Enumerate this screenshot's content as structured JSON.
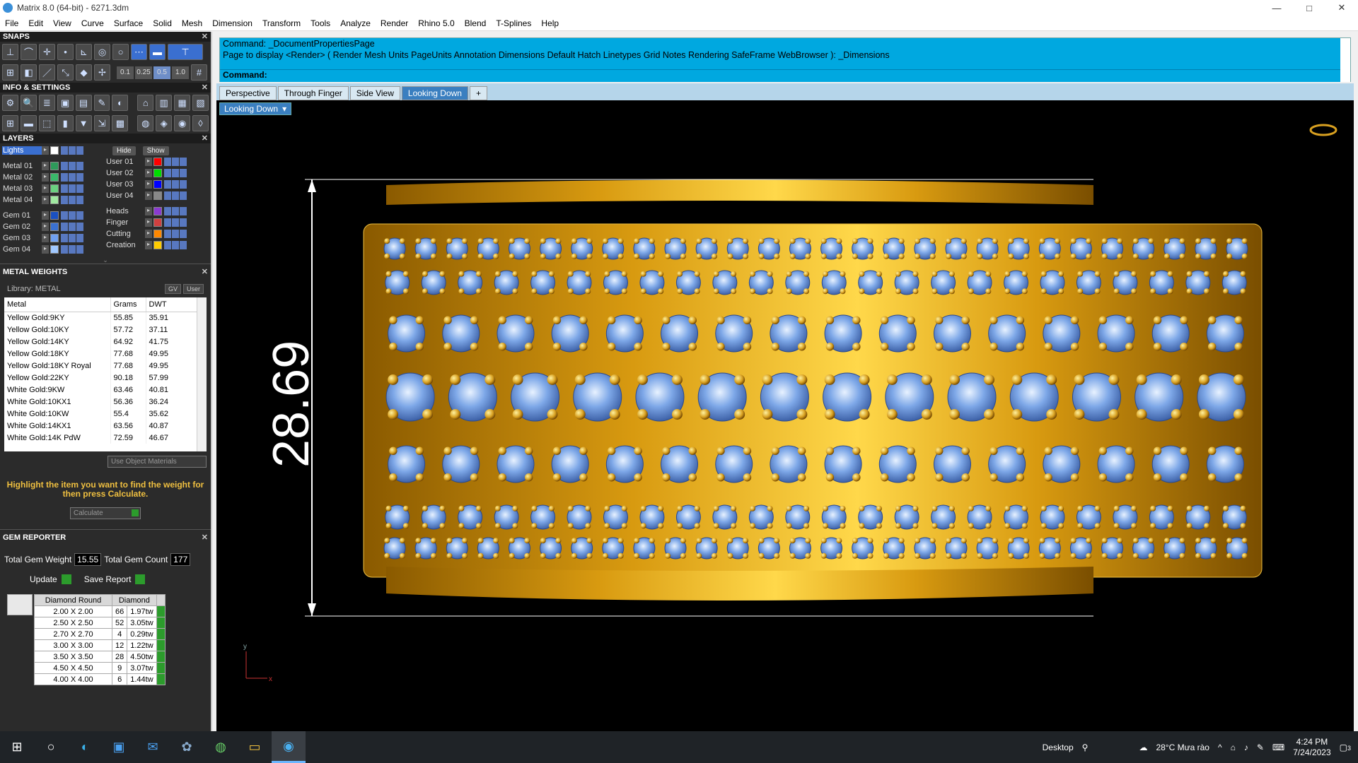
{
  "window": {
    "title": "Matrix 8.0 (64-bit) - 6271.3dm",
    "minimize": "—",
    "maximize": "□",
    "close": "✕"
  },
  "menu": [
    "File",
    "Edit",
    "View",
    "Curve",
    "Surface",
    "Solid",
    "Mesh",
    "Dimension",
    "Transform",
    "Tools",
    "Analyze",
    "Render",
    "Rhino 5.0",
    "Blend",
    "T-Splines",
    "Help"
  ],
  "panels": {
    "snaps": {
      "title": "SNAPS",
      "values": [
        "0.1",
        "0.25",
        "0.5",
        "1.0"
      ],
      "selected": "0.5"
    },
    "info": {
      "title": "INFO & SETTINGS"
    },
    "layers": {
      "title": "LAYERS",
      "hide": "Hide",
      "show": "Show",
      "left": [
        [
          "Lights",
          "#ffffff"
        ],
        [
          "Metal 01",
          "#2e9a5a"
        ],
        [
          "Metal 02",
          "#3ab86a"
        ],
        [
          "Metal 03",
          "#6ad080"
        ],
        [
          "Metal 04",
          "#a0e8a0"
        ],
        [
          "Gem 01",
          "#1a50c0"
        ],
        [
          "Gem 02",
          "#3a70d0"
        ],
        [
          "Gem 03",
          "#70a0f0"
        ],
        [
          "Gem 04",
          "#a0c8ff"
        ]
      ],
      "right": [
        [
          "User 01",
          "#ff0000"
        ],
        [
          "User 02",
          "#00dd00"
        ],
        [
          "User 03",
          "#0000ff"
        ],
        [
          "User 04",
          "#888888"
        ],
        [
          "Heads",
          "#8a3ad0"
        ],
        [
          "Finger",
          "#d04040"
        ],
        [
          "Cutting",
          "#ff8800"
        ],
        [
          "Creation",
          "#ffcc00"
        ]
      ]
    },
    "metal": {
      "title": "METAL WEIGHTS",
      "library": "Library: METAL",
      "gv": "GV",
      "user": "User",
      "headers": [
        "Metal",
        "Grams",
        "DWT"
      ],
      "rows": [
        [
          "Yellow Gold:9KY",
          "55.85",
          "35.91"
        ],
        [
          "Yellow Gold:10KY",
          "57.72",
          "37.11"
        ],
        [
          "Yellow Gold:14KY",
          "64.92",
          "41.75"
        ],
        [
          "Yellow Gold:18KY",
          "77.68",
          "49.95"
        ],
        [
          "Yellow Gold:18KY Royal",
          "77.68",
          "49.95"
        ],
        [
          "Yellow Gold:22KY",
          "90.18",
          "57.99"
        ],
        [
          "White Gold:9KW",
          "63.46",
          "40.81"
        ],
        [
          "White Gold:10KX1",
          "56.36",
          "36.24"
        ],
        [
          "White Gold:10KW",
          "55.4",
          "35.62"
        ],
        [
          "White Gold:14KX1",
          "63.56",
          "40.87"
        ],
        [
          "White Gold:14K PdW",
          "72.59",
          "46.67"
        ]
      ],
      "useobj": "Use Object Materials",
      "hint": "Highlight the item you want to find the weight for then press Calculate.",
      "calculate": "Calculate"
    },
    "gem": {
      "title": "GEM REPORTER",
      "total_weight_label": "Total Gem Weight",
      "total_weight": "15.55",
      "total_count_label": "Total Gem Count",
      "total_count": "177",
      "update": "Update",
      "save": "Save Report",
      "headers": [
        "Diamond Round",
        "Diamond"
      ],
      "rows": [
        [
          "2.00 X 2.00",
          "66",
          "1.97tw"
        ],
        [
          "2.50 X 2.50",
          "52",
          "3.05tw"
        ],
        [
          "2.70 X 2.70",
          "4",
          "0.29tw"
        ],
        [
          "3.00 X 3.00",
          "12",
          "1.22tw"
        ],
        [
          "3.50 X 3.50",
          "28",
          "4.50tw"
        ],
        [
          "4.50 X 4.50",
          "9",
          "3.07tw"
        ],
        [
          "4.00 X 4.00",
          "6",
          "1.44tw"
        ]
      ]
    }
  },
  "command": {
    "line1": "Command: _DocumentPropertiesPage",
    "line2": "Page to display <Render> ( Render  Mesh  Units  PageUnits  Annotation  Dimensions  Default  Hatch  Linetypes  Grid  Notes  Rendering  SafeFrame  WebBrowser ): _Dimensions",
    "prompt": "Command:"
  },
  "tabs": [
    "Perspective",
    "Through Finger",
    "Side View",
    "Looking Down",
    "+"
  ],
  "active_tab": "Looking Down",
  "viewport": {
    "label": "Looking Down",
    "dimension": "28.69",
    "axis_y": "y",
    "axis_x": "x"
  },
  "taskbar": {
    "desktop": "Desktop",
    "weather": "28°C  Mưa rào",
    "time": "4:24 PM",
    "date": "7/24/2023",
    "notif": "3"
  }
}
